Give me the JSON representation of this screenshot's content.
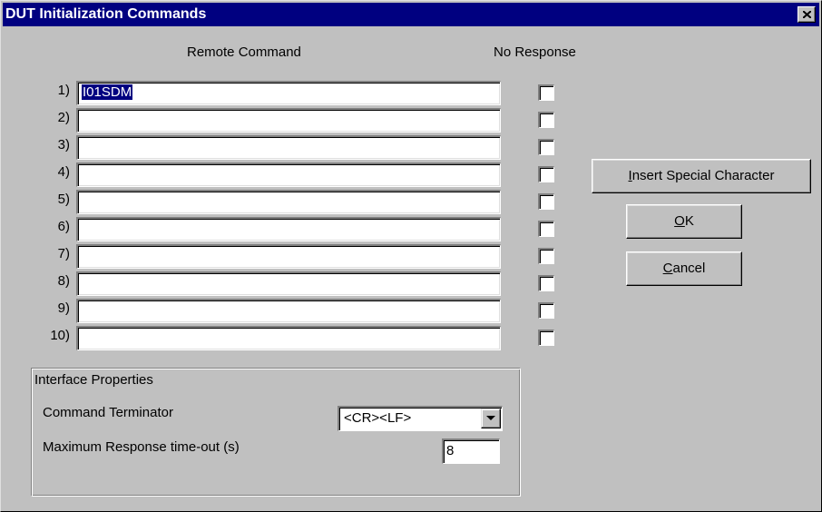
{
  "window": {
    "title": "DUT Initialization Commands"
  },
  "headers": {
    "remote_command": "Remote Command",
    "no_response": "No Response"
  },
  "rows": [
    {
      "num": "1)",
      "value": "I01SDM",
      "checked": false
    },
    {
      "num": "2)",
      "value": "",
      "checked": false
    },
    {
      "num": "3)",
      "value": "",
      "checked": false
    },
    {
      "num": "4)",
      "value": "",
      "checked": false
    },
    {
      "num": "5)",
      "value": "",
      "checked": false
    },
    {
      "num": "6)",
      "value": "",
      "checked": false
    },
    {
      "num": "7)",
      "value": "",
      "checked": false
    },
    {
      "num": "8)",
      "value": "",
      "checked": false
    },
    {
      "num": "9)",
      "value": "",
      "checked": false
    },
    {
      "num": "10)",
      "value": "",
      "checked": false
    }
  ],
  "buttons": {
    "insert_special": {
      "mnemonic": "I",
      "rest": "nsert Special Character"
    },
    "ok": {
      "mnemonic": "O",
      "rest": "K"
    },
    "cancel": {
      "mnemonic": "C",
      "rest": "ancel"
    }
  },
  "interface": {
    "group_label": "Interface Properties",
    "terminator_label": "Command Terminator",
    "terminator_value": "<CR><LF>",
    "timeout_label": "Maximum Response time-out (s)",
    "timeout_value": "8"
  },
  "icons": {
    "close": "close-icon",
    "dropdown": "chevron-down-icon"
  },
  "colors": {
    "titlebar": "#000080",
    "face": "#c0c0c0",
    "selection": "#000080"
  }
}
